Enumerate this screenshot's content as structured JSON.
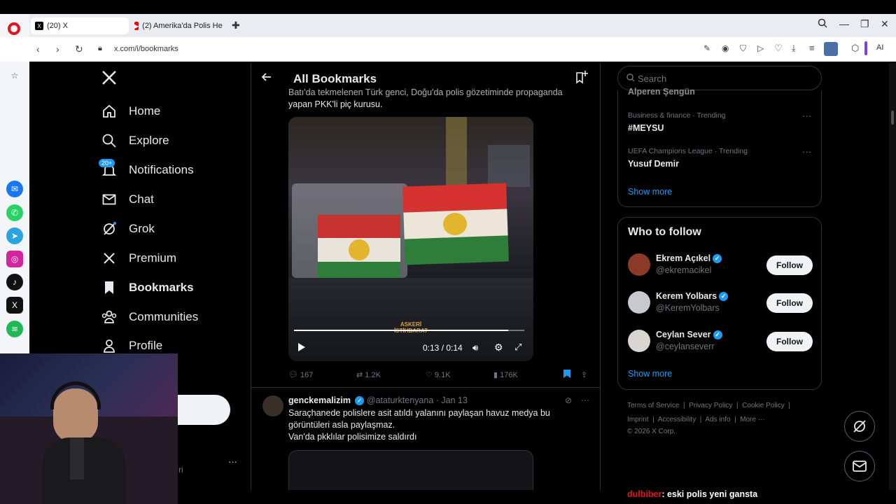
{
  "browser": {
    "tabs": [
      {
        "label": "(20) X",
        "active": true
      },
      {
        "label": "(2) Amerika'da Polis Her Ş",
        "active": false
      }
    ],
    "url": "x.com/i/bookmarks",
    "ai_label": "AI"
  },
  "leftnav": {
    "items": [
      {
        "label": "Home",
        "icon": "home-icon"
      },
      {
        "label": "Explore",
        "icon": "search-icon"
      },
      {
        "label": "Notifications",
        "icon": "bell-icon"
      },
      {
        "label": "Chat",
        "icon": "mail-icon"
      },
      {
        "label": "Grok",
        "icon": "grok-icon"
      },
      {
        "label": "Premium",
        "icon": "x-logo-icon"
      },
      {
        "label": "Bookmarks",
        "icon": "bookmark-icon"
      },
      {
        "label": "Communities",
        "icon": "people-icon"
      },
      {
        "label": "Profile",
        "icon": "person-icon"
      }
    ],
    "notifications_badge": "20+",
    "account_name_partial": "i",
    "account_handle_partial": "ri",
    "more_dots": "···"
  },
  "center": {
    "header_title": "All Bookmarks",
    "tweet1": {
      "text_line1": "Batı'da tekmelenen Türk genci, Doğu'da polis gözetiminde propaganda",
      "text_line2": "yapan PKK'li piç kurusu.",
      "video_time": "0:13 / 0:14",
      "video_watermark_1": "ASKERİ",
      "video_watermark_2": "İSTİHBARAT",
      "video_progress": 0.93,
      "replies": "167",
      "retweets": "1.2K",
      "likes": "9.1K",
      "views": "176K"
    },
    "tweet2": {
      "display_name": "genckemalizim",
      "handle": "@ataturktenyana",
      "date": "· Jan 13",
      "line1": "Saraçhanede polislere asit atıldı yalanını paylaşan havuz medya bu",
      "line2": "görüntüleri asla paylaşmaz.",
      "line3": "Van'da pkklılar polisimize saldırdı"
    }
  },
  "right": {
    "search_placeholder": "Search",
    "trend_top_partial": "Alperen Şengün",
    "trends": [
      {
        "category": "Business & finance · Trending",
        "name": "#MEYSU"
      },
      {
        "category": "UEFA Champions League · Trending",
        "name": "Yusuf Demir"
      }
    ],
    "show_more": "Show more",
    "who_to_follow_title": "Who to follow",
    "follow": [
      {
        "name": "Ekrem Açıkel",
        "handle": "@ekremacikel",
        "button": "Follow"
      },
      {
        "name": "Kerem Yolbars",
        "handle": "@KeremYolbars",
        "button": "Follow"
      },
      {
        "name": "Ceylan Sever",
        "handle": "@ceylanseverr",
        "button": "Follow"
      }
    ],
    "show_more_2": "Show more",
    "footer": {
      "line1": [
        "Terms of Service",
        "Privacy Policy",
        "Cookie Policy"
      ],
      "line2": [
        "Imprint",
        "Accessibility",
        "Ads info",
        "More ···"
      ],
      "copyright": "© 2026 X Corp."
    }
  },
  "overlay": {
    "chat_user": "dulbiber",
    "chat_message": ": eski polis yeni gansta"
  },
  "colors": {
    "accent": "#1d9bf0",
    "text": "#e7e9ea",
    "muted": "#71767b",
    "border": "#2f3336",
    "opera_red": "#e3141d"
  }
}
